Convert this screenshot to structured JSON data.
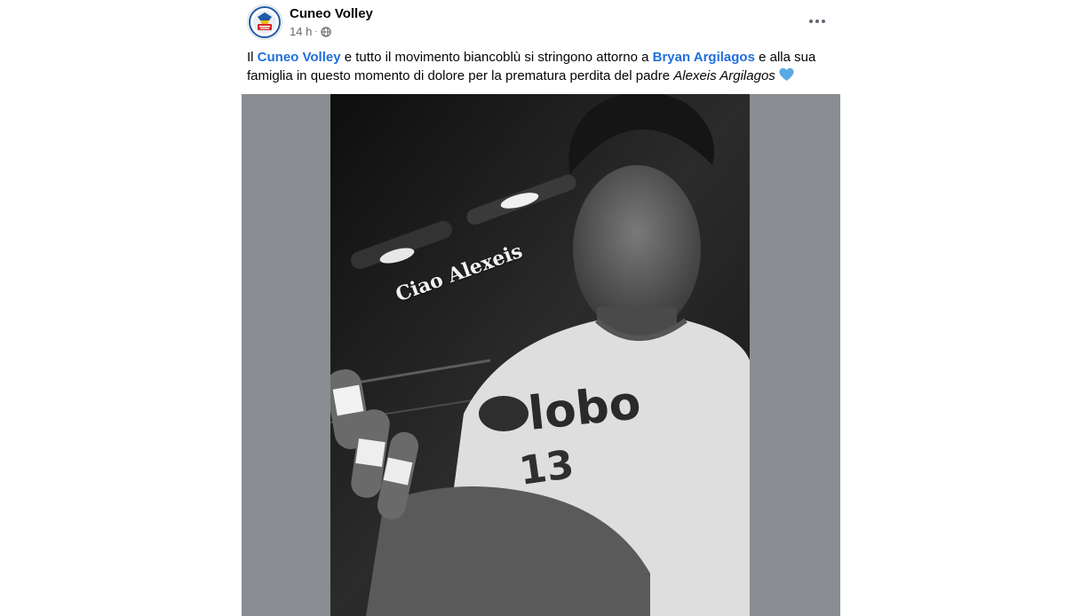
{
  "post": {
    "page_name": "Cuneo Volley",
    "timestamp": "14 h",
    "visibility_icon": "globe-icon",
    "more_icon": "more-options-icon",
    "caption": {
      "t1": "Il ",
      "link1": "Cuneo Volley",
      "t2": " e tutto il movimento biancoblù si stringono attorno a ",
      "link2": "Bryan Argilagos",
      "t3": " e alla sua famiglia in questo momento di dolore per la prematura perdita del padre ",
      "italic": "Alexeis Argilagos",
      "emoji": "blue-heart-icon"
    },
    "photo": {
      "overlay_text": "Ciao Alexeis",
      "jersey_text": "lobo",
      "jersey_number": "13"
    }
  },
  "colors": {
    "link": "#216fdb",
    "media_background": "#8a8d91"
  }
}
